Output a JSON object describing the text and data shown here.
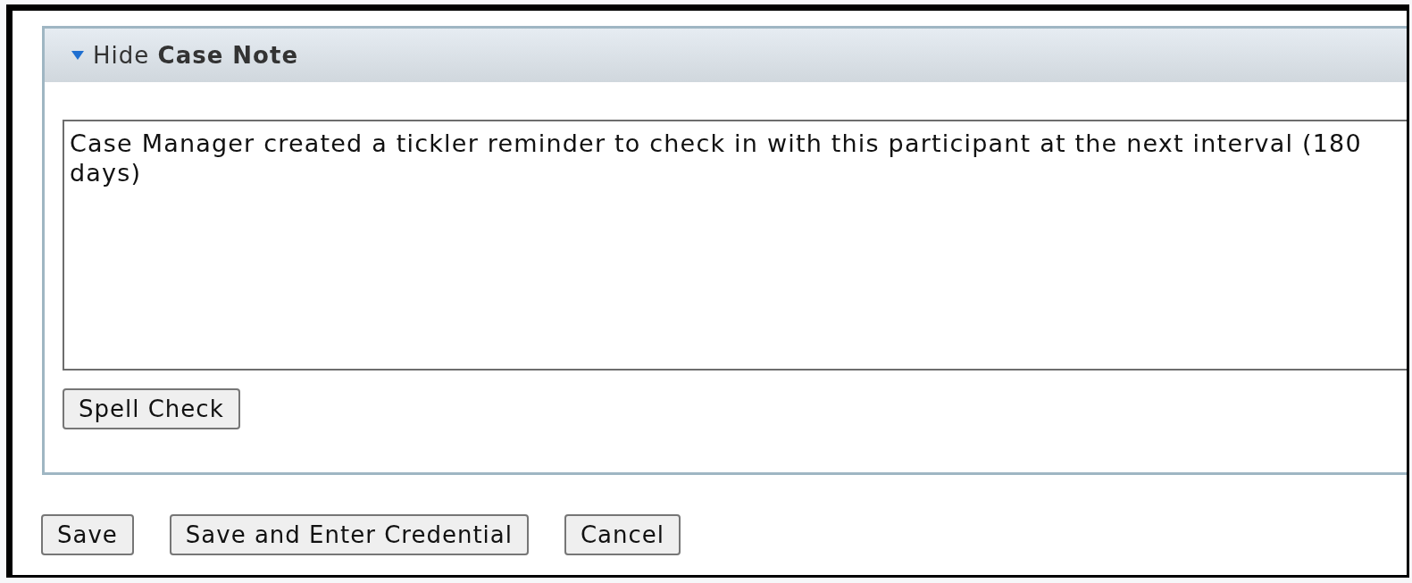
{
  "case_note_panel": {
    "toggle_label": "Hide ",
    "title": "Case Note",
    "expanded": true,
    "note": {
      "value": "Case Manager created a tickler reminder to check in with this participant at the next interval (180 days)"
    },
    "spell_check_button": "Spell Check"
  },
  "buttons": [
    "Save",
    "Save and Enter Credential",
    "Cancel"
  ]
}
